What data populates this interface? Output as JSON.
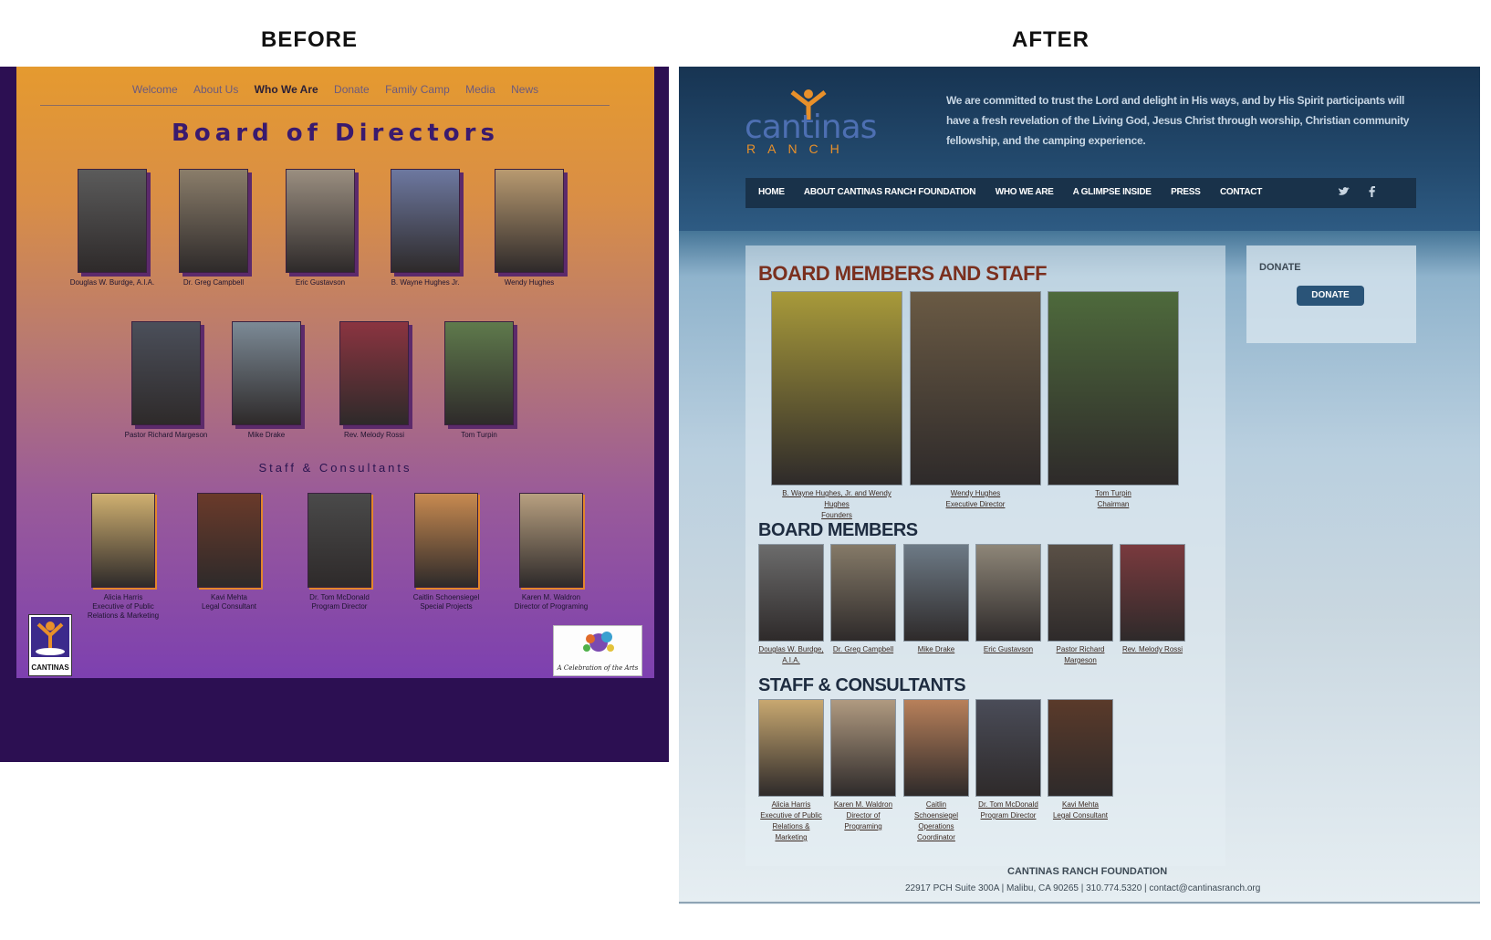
{
  "headings": {
    "before": "BEFORE",
    "after": "AFTER"
  },
  "before": {
    "nav": [
      "Welcome",
      "About Us",
      "Who We Are",
      "Donate",
      "Family Camp",
      "Media",
      "News"
    ],
    "nav_active": "Who We Are",
    "title": "Board of Directors",
    "subtitle": "Staff & Consultants",
    "board_row1": [
      {
        "name": "Douglas W. Burdge, A.I.A.",
        "color": "#5b5b5b"
      },
      {
        "name": "Dr. Greg Campbell",
        "color": "#8a7d6a"
      },
      {
        "name": "Eric Gustavson",
        "color": "#9a8e80"
      },
      {
        "name": "B. Wayne Hughes Jr.",
        "color": "#6d78a0"
      },
      {
        "name": "Wendy Hughes",
        "color": "#b89a70"
      }
    ],
    "board_row2": [
      {
        "name": "Pastor Richard Margeson",
        "color": "#4b4f5a"
      },
      {
        "name": "Mike Drake",
        "color": "#7c8a96"
      },
      {
        "name": "Rev. Melody Rossi",
        "color": "#8b3440"
      },
      {
        "name": "Tom Turpin",
        "color": "#5f7a4c"
      }
    ],
    "staff": [
      {
        "name": "Alicia Harris",
        "role": "Executive of Public",
        "role2": "Relations & Marketing",
        "color": "#d0b070"
      },
      {
        "name": "Kavi Mehta",
        "role": "Legal Consultant",
        "role2": "",
        "color": "#6a3a2a"
      },
      {
        "name": "Dr. Tom McDonald",
        "role": "Program Director",
        "role2": "",
        "color": "#4a4a4a"
      },
      {
        "name": "Caitlin Schoensiegel",
        "role": "Special Projects",
        "role2": "",
        "color": "#c88a50"
      },
      {
        "name": "Karen M. Waldron",
        "role": "Director of Programing",
        "role2": "",
        "color": "#b8a080"
      }
    ],
    "logo_text": "CANTINAS",
    "badge_text": "A Celebration of the Arts"
  },
  "after": {
    "logo_word": "cantinas",
    "logo_sub": "RANCH",
    "mission": "We are committed to trust the Lord and delight in His ways, and by His Spirit participants will have a fresh revelation of the Living God, Jesus Christ through worship, Christian community fellowship, and the camping experience.",
    "nav": [
      "HOME",
      "ABOUT CANTINAS RANCH FOUNDATION",
      "WHO WE ARE",
      "A GLIMPSE INSIDE",
      "PRESS",
      "CONTACT"
    ],
    "social": {
      "twitter": "twitter-icon",
      "facebook": "facebook-icon"
    },
    "page_title": "BOARD MEMBERS AND STAFF",
    "featured": [
      {
        "name": "B. Wayne Hughes, Jr. and Wendy Hughes",
        "role": "Founders",
        "color": "#a89a3a"
      },
      {
        "name": "Wendy Hughes",
        "role": "Executive Director",
        "color": "#6a5a44"
      },
      {
        "name": "Tom Turpin",
        "role": "Chairman",
        "color": "#4e6a3c"
      }
    ],
    "board_title": "BOARD MEMBERS",
    "board": [
      {
        "name": "Douglas W. Burdge, A.I.A.",
        "color": "#6c6c6c"
      },
      {
        "name": "Dr. Greg Campbell",
        "color": "#857a68"
      },
      {
        "name": "Mike Drake",
        "color": "#6d7a86"
      },
      {
        "name": "Eric Gustavson",
        "color": "#8e8678"
      },
      {
        "name": "Pastor Richard Margeson",
        "color": "#5a5046"
      },
      {
        "name": "Rev. Melody Rossi",
        "color": "#7a3a3e"
      }
    ],
    "staff_title": "STAFF & CONSULTANTS",
    "staff": [
      {
        "name": "Alicia Harris",
        "role": "Executive of Public",
        "role2": "Relations & Marketing",
        "color": "#c8a870"
      },
      {
        "name": "Karen M. Waldron",
        "role": "Director of Programing",
        "role2": "",
        "color": "#b09a80"
      },
      {
        "name": "Caitlin Schoensiegel",
        "role": "Operations Coordinator",
        "role2": "",
        "color": "#b8805a"
      },
      {
        "name": "Dr. Tom McDonald",
        "role": "Program Director",
        "role2": "",
        "color": "#4a4c58"
      },
      {
        "name": "Kavi Mehta",
        "role": "Legal Consultant",
        "role2": "",
        "color": "#5a3a2a"
      }
    ],
    "sidebar_title": "DONATE",
    "donate_button": "DONATE",
    "footer_title": "CANTINAS RANCH FOUNDATION",
    "footer_address": "22917 PCH Suite 300A | Malibu, CA 90265 | 310.774.5320 | contact@cantinasranch.org",
    "colors": {
      "header_title": "#7a2f1e",
      "section_title": "#1e2c40"
    }
  }
}
